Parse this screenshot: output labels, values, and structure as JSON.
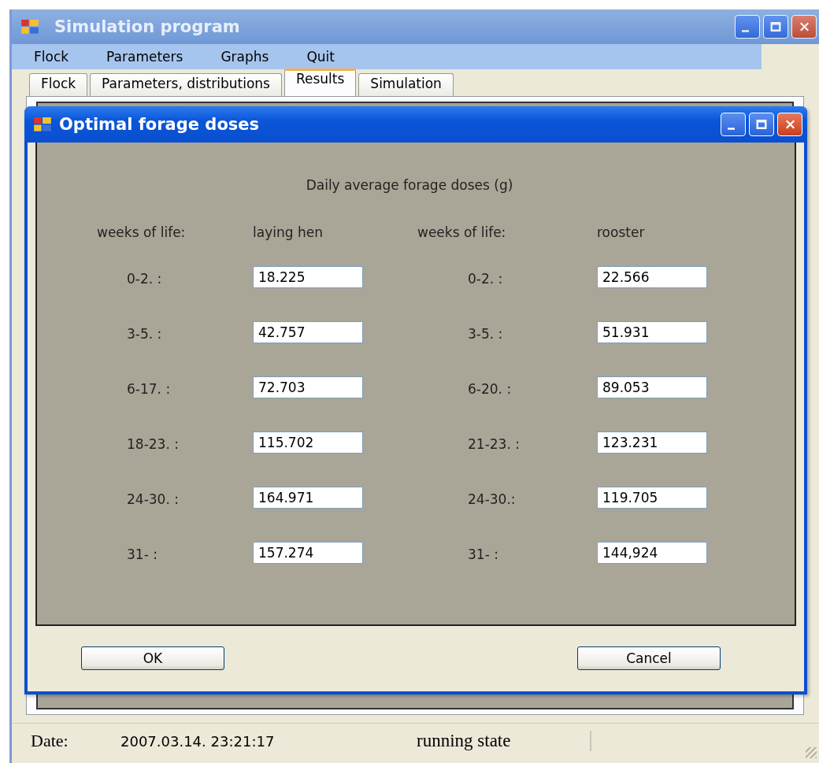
{
  "window": {
    "title": "Simulation program"
  },
  "menu": [
    "Flock",
    "Parameters",
    "Graphs",
    "Quit"
  ],
  "tabs": [
    {
      "label": "Flock",
      "selected": false
    },
    {
      "label": "Parameters, distributions",
      "selected": false
    },
    {
      "label": "Results",
      "selected": true
    },
    {
      "label": "Simulation",
      "selected": false
    }
  ],
  "dialog": {
    "title": "Optimal forage doses",
    "heading": "Daily average forage doses (g)",
    "columns": [
      "weeks of life:",
      "laying hen",
      "weeks of life:",
      "rooster"
    ],
    "rows": [
      {
        "hen_weeks": "0-2. :",
        "hen": "18.225",
        "rooster_weeks": "0-2. :",
        "rooster": "22.566"
      },
      {
        "hen_weeks": "3-5. :",
        "hen": "42.757",
        "rooster_weeks": "3-5. :",
        "rooster": "51.931"
      },
      {
        "hen_weeks": "6-17. :",
        "hen": "72.703",
        "rooster_weeks": "6-20. :",
        "rooster": "89.053"
      },
      {
        "hen_weeks": "18-23. :",
        "hen": "115.702",
        "rooster_weeks": "21-23. :",
        "rooster": "123.231"
      },
      {
        "hen_weeks": "24-30. :",
        "hen": "164.971",
        "rooster_weeks": "24-30.:",
        "rooster": "119.705"
      },
      {
        "hen_weeks": "31- :",
        "hen": "157.274",
        "rooster_weeks": "31- :",
        "rooster": "144,924"
      }
    ],
    "buttons": [
      "OK",
      "Cancel"
    ]
  },
  "status_bar": {
    "date_label": "Date:",
    "date": "2007.03.14. 23:21:17",
    "state": "running state"
  }
}
